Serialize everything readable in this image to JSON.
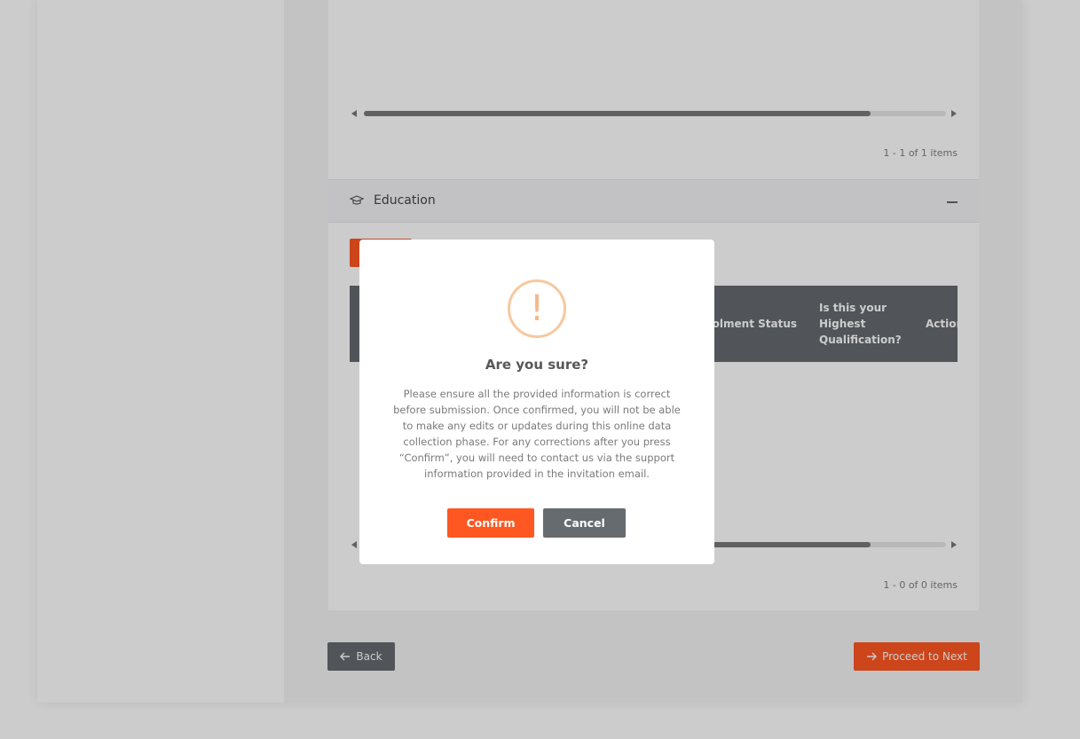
{
  "employment_section": {
    "pager_text": "1 - 1 of 1 items",
    "scroll_fraction": 0.87
  },
  "education_section": {
    "title": "Education",
    "icon": "graduation-cap-icon",
    "collapse_icon": "minus-icon",
    "grid": {
      "columns": [
        "Enrolment Status",
        "Is this your Highest Qualification?",
        "Action"
      ]
    },
    "pager_text": "1 - 0 of 0 items",
    "scroll_fraction": 0.87
  },
  "footer": {
    "back_label": "Back",
    "next_label": "Proceed to Next"
  },
  "dialog": {
    "icon": "!",
    "title": "Are you sure?",
    "body": "Please ensure all the provided information is correct before submission. Once confirmed, you will not be able to make any edits or updates during this online data collection phase. For any corrections after you press “Confirm”, you will need to contact us via the support information provided in the invitation email.",
    "confirm_label": "Confirm",
    "cancel_label": "Cancel"
  },
  "colors": {
    "accent": "#ff5722",
    "secondary": "#666b70",
    "warning": "#f8c89e"
  }
}
